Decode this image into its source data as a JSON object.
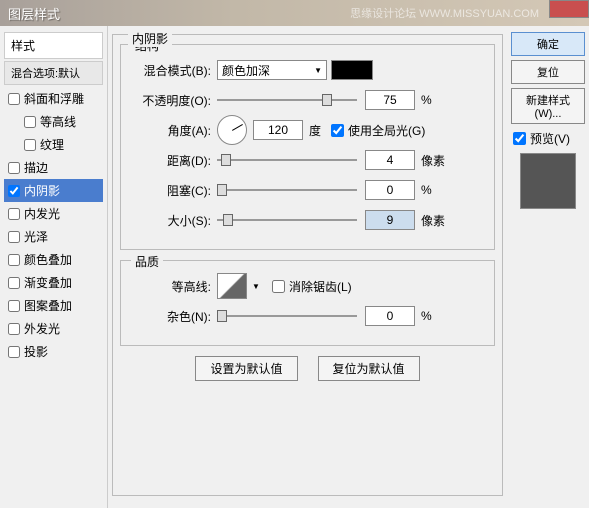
{
  "titlebar": {
    "title": "图层样式",
    "watermark": "思缘设计论坛 WWW.MISSYUAN.COM"
  },
  "left": {
    "header": "样式",
    "blend_options": "混合选项:默认",
    "items": [
      {
        "label": "斜面和浮雕",
        "checked": false,
        "indent": false
      },
      {
        "label": "等高线",
        "checked": false,
        "indent": true
      },
      {
        "label": "纹理",
        "checked": false,
        "indent": true
      },
      {
        "label": "描边",
        "checked": false,
        "indent": false
      },
      {
        "label": "内阴影",
        "checked": true,
        "indent": false,
        "selected": true
      },
      {
        "label": "内发光",
        "checked": false,
        "indent": false
      },
      {
        "label": "光泽",
        "checked": false,
        "indent": false
      },
      {
        "label": "颜色叠加",
        "checked": false,
        "indent": false
      },
      {
        "label": "渐变叠加",
        "checked": false,
        "indent": false
      },
      {
        "label": "图案叠加",
        "checked": false,
        "indent": false
      },
      {
        "label": "外发光",
        "checked": false,
        "indent": false
      },
      {
        "label": "投影",
        "checked": false,
        "indent": false
      }
    ]
  },
  "center": {
    "title": "内阴影",
    "structure": {
      "group_title": "结构",
      "blend_mode_label": "混合模式(B):",
      "blend_mode_value": "颜色加深",
      "opacity_label": "不透明度(O):",
      "opacity_value": "75",
      "opacity_unit": "%",
      "angle_label": "角度(A):",
      "angle_value": "120",
      "angle_unit": "度",
      "global_light_label": "使用全局光(G)",
      "distance_label": "距离(D):",
      "distance_value": "4",
      "distance_unit": "像素",
      "choke_label": "阻塞(C):",
      "choke_value": "0",
      "choke_unit": "%",
      "size_label": "大小(S):",
      "size_value": "9",
      "size_unit": "像素"
    },
    "quality": {
      "group_title": "品质",
      "contour_label": "等高线:",
      "antialias_label": "消除锯齿(L)",
      "noise_label": "杂色(N):",
      "noise_value": "0",
      "noise_unit": "%"
    },
    "buttons": {
      "set_default": "设置为默认值",
      "reset_default": "复位为默认值"
    }
  },
  "right": {
    "ok": "确定",
    "cancel": "复位",
    "new_style": "新建样式(W)...",
    "preview_label": "预览(V)"
  }
}
